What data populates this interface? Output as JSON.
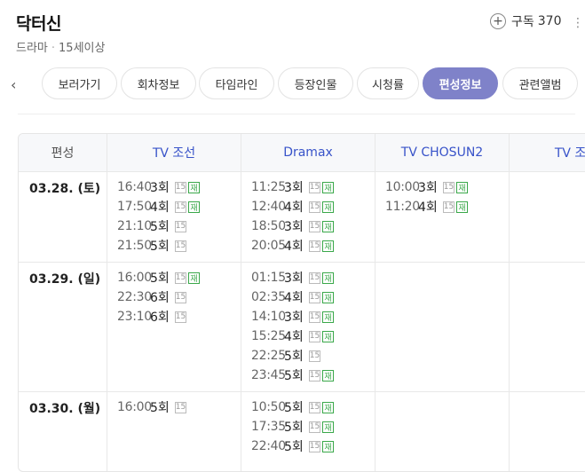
{
  "header": {
    "title": "닥터신",
    "genre": "드라마",
    "rating": "15세이상",
    "plus_icon": "+",
    "subscribe_label": "구독",
    "subscribe_count": "370",
    "more_icon": "⋮"
  },
  "tabs": {
    "prev_icon": "‹",
    "items": [
      "보러가기",
      "회차정보",
      "타임라인",
      "등장인물",
      "시청률",
      "편성정보",
      "관련앨범"
    ],
    "active": "편성정보"
  },
  "schedule": {
    "header_first": "편성",
    "channels": [
      "TV 조선",
      "Dramax",
      "TV CHOSUN2",
      "TV 조선"
    ],
    "badge_15": "15",
    "badge_re": "재",
    "days": [
      {
        "date": "03.28. (토)",
        "slots": [
          [
            {
              "time": "16:40",
              "ep": "3회",
              "re": true
            },
            {
              "time": "17:50",
              "ep": "4회",
              "re": true
            },
            {
              "time": "21:10",
              "ep": "5회",
              "re": false
            },
            {
              "time": "21:50",
              "ep": "5회",
              "re": false
            }
          ],
          [
            {
              "time": "11:25",
              "ep": "3회",
              "re": true
            },
            {
              "time": "12:40",
              "ep": "4회",
              "re": true
            },
            {
              "time": "18:50",
              "ep": "3회",
              "re": true
            },
            {
              "time": "20:05",
              "ep": "4회",
              "re": true
            }
          ],
          [
            {
              "time": "10:00",
              "ep": "3회",
              "re": true
            },
            {
              "time": "11:20",
              "ep": "4회",
              "re": true
            }
          ],
          []
        ]
      },
      {
        "date": "03.29. (일)",
        "slots": [
          [
            {
              "time": "16:00",
              "ep": "5회",
              "re": true
            },
            {
              "time": "22:30",
              "ep": "6회",
              "re": false
            },
            {
              "time": "23:10",
              "ep": "6회",
              "re": false
            }
          ],
          [
            {
              "time": "01:15",
              "ep": "3회",
              "re": true
            },
            {
              "time": "02:35",
              "ep": "4회",
              "re": true
            },
            {
              "time": "14:10",
              "ep": "3회",
              "re": true
            },
            {
              "time": "15:25",
              "ep": "4회",
              "re": true
            },
            {
              "time": "22:25",
              "ep": "5회",
              "re": false
            },
            {
              "time": "23:45",
              "ep": "5회",
              "re": true
            }
          ],
          [],
          []
        ]
      },
      {
        "date": "03.30. (월)",
        "slots": [
          [
            {
              "time": "16:00",
              "ep": "5회",
              "re": false
            }
          ],
          [
            {
              "time": "10:50",
              "ep": "5회",
              "re": true
            },
            {
              "time": "17:35",
              "ep": "5회",
              "re": true
            },
            {
              "time": "22:40",
              "ep": "5회",
              "re": true
            }
          ],
          [],
          []
        ]
      }
    ]
  }
}
